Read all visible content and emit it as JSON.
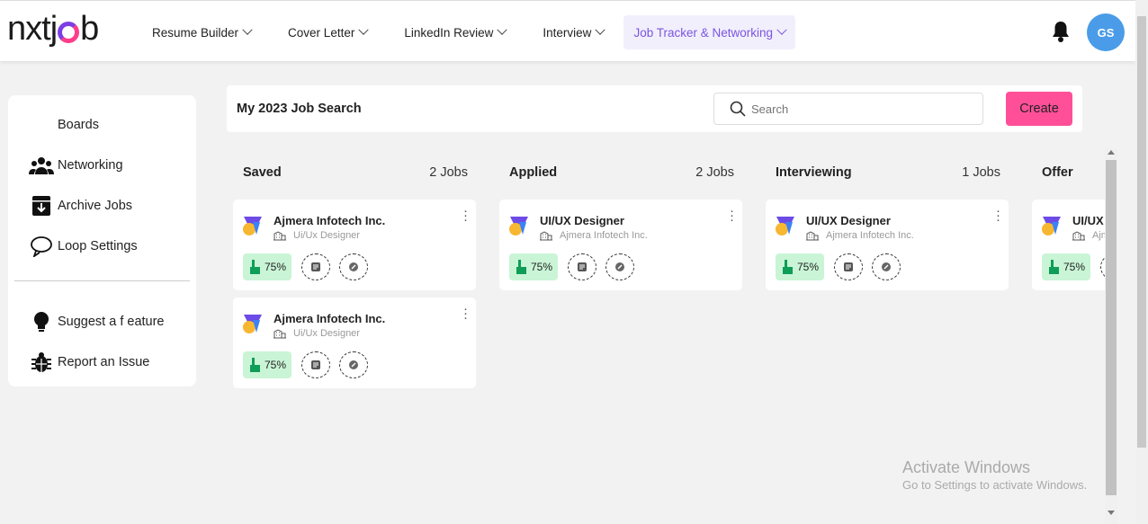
{
  "brand": {
    "logo_text_left": "nxtj",
    "logo_text_right": "b"
  },
  "nav": [
    {
      "label": "Resume Builder",
      "active": false
    },
    {
      "label": "Cover Letter",
      "active": false
    },
    {
      "label": "LinkedIn Review",
      "active": false
    },
    {
      "label": "Interview",
      "active": false
    },
    {
      "label": "Job Tracker & Networking",
      "active": true
    }
  ],
  "header": {
    "bell_icon": "bell-icon",
    "avatar_initials": "GS"
  },
  "sidebar": {
    "items": [
      {
        "label": "Boards",
        "icon": "none"
      },
      {
        "label": "Networking",
        "icon": "people-icon"
      },
      {
        "label": "Archive Jobs",
        "icon": "archive-icon"
      },
      {
        "label": "Loop Settings",
        "icon": "chat-bubble-icon"
      }
    ],
    "bottom_items": [
      {
        "label": "Suggest a f eature",
        "icon": "lightbulb-icon"
      },
      {
        "label": "Report an Issue",
        "icon": "bug-icon"
      }
    ]
  },
  "board": {
    "title": "My 2023 Job Search",
    "search_placeholder": "Search",
    "create_label": "Create",
    "columns": [
      {
        "name": "Saved",
        "count": "2 Jobs",
        "cards": [
          {
            "title": "Ajmera Infotech Inc.",
            "subtitle": "Ui/Ux Designer",
            "score": "75%"
          },
          {
            "title": "Ajmera Infotech Inc.",
            "subtitle": "Ui/Ux Designer",
            "score": "75%"
          }
        ]
      },
      {
        "name": "Applied",
        "count": "2 Jobs",
        "cards": [
          {
            "title": "UI/UX Designer",
            "subtitle": "Ajmera Infotech Inc.",
            "score": "75%"
          }
        ]
      },
      {
        "name": "Interviewing",
        "count": "1 Jobs",
        "cards": [
          {
            "title": "UI/UX Designer",
            "subtitle": "Ajmera Infotech Inc.",
            "score": "75%"
          }
        ]
      },
      {
        "name": "Offer",
        "count": "",
        "cards": [
          {
            "title": "UI/UX Designer",
            "subtitle": "Ajmera Infotech Inc.",
            "score": "75%"
          }
        ]
      }
    ]
  },
  "watermark": {
    "title": "Activate Windows",
    "subtitle": "Go to Settings to activate Windows."
  },
  "colors": {
    "accent_purple": "#7a55e0",
    "create_pink": "#ff4f99",
    "score_green": "#c9f5d6",
    "avatar_blue": "#4a9ce8"
  }
}
